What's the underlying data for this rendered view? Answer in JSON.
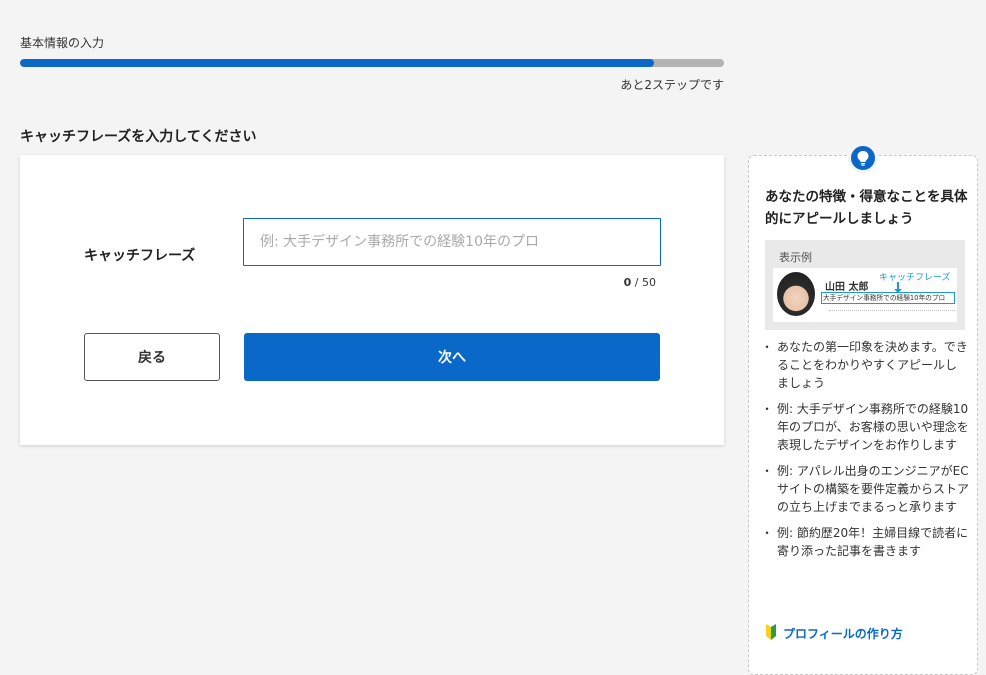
{
  "progress": {
    "label": "基本情報の入力",
    "value": 0.9,
    "remaining": "あと2ステップです"
  },
  "form": {
    "section_title": "キャッチフレーズを入力してください",
    "field_label": "キャッチフレーズ",
    "input_value": "",
    "input_placeholder": "例: 大手デザイン事務所での経験10年のプロ",
    "counter_current": "0",
    "counter_max": "/ 50",
    "back_label": "戻る",
    "next_label": "次へ"
  },
  "tips": {
    "icon": "lightbulb-icon",
    "heading": "あなたの特徴・得意なことを具体的にアピールしましょう",
    "example": {
      "title": "表示例",
      "name": "山田 太郎",
      "catch_label": "キャッチフレーズ",
      "catch_text": "大手デザイン事務所での経験10年のプロ"
    },
    "items": [
      "あなたの第一印象を決めます。できることをわかりやすくアピールしましょう",
      "例: 大手デザイン事務所での経験10年のプロが、お客様の思いや理念を表現したデザインをお作りします",
      "例: アパレル出身のエンジニアがECサイトの構築を要件定義からストアの立ち上げまでまるっと承ります",
      "例: 節約歴20年！主婦目線で読者に寄り添った記事を書きます"
    ],
    "link_label": "プロフィールの作り方",
    "link_icon": "beginner-mark-icon"
  },
  "colors": {
    "accent": "#0a68c8",
    "track": "#b3b3b3",
    "example_accent": "#1a9bd7"
  }
}
